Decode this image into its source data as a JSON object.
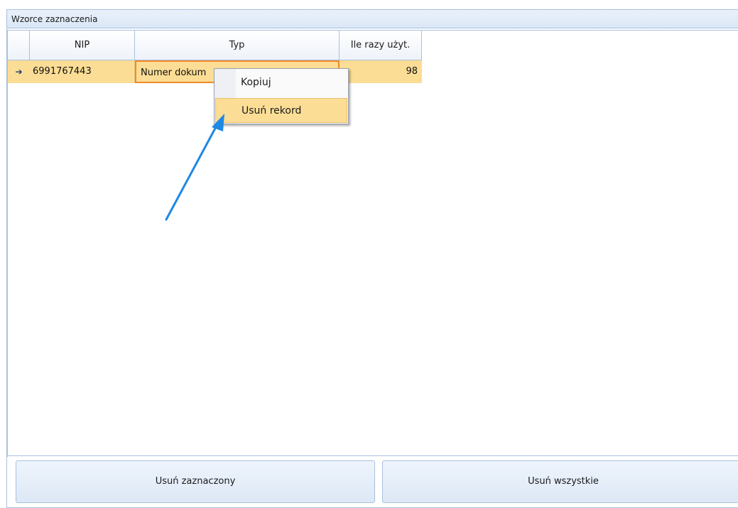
{
  "panel": {
    "title": "Wzorce zaznaczenia"
  },
  "grid": {
    "columns": [
      "NIP",
      "Typ",
      "Ile razy użyt."
    ],
    "rows": [
      {
        "indicator": "➔",
        "nip": "6991767443",
        "typ": "Numer dokum",
        "count": "98"
      }
    ]
  },
  "context_menu": {
    "items": [
      {
        "label": "Kopiuj"
      },
      {
        "label": "Usuń rekord"
      }
    ]
  },
  "buttons": {
    "delete_selected": "Usuń zaznaczony",
    "delete_all": "Usuń wszystkie"
  },
  "colors": {
    "selection": "#fcdd95",
    "focus_border": "#ef8a2a",
    "arrow": "#1e88e5"
  },
  "annotation": {
    "icon": "arrow-annotation-icon"
  }
}
